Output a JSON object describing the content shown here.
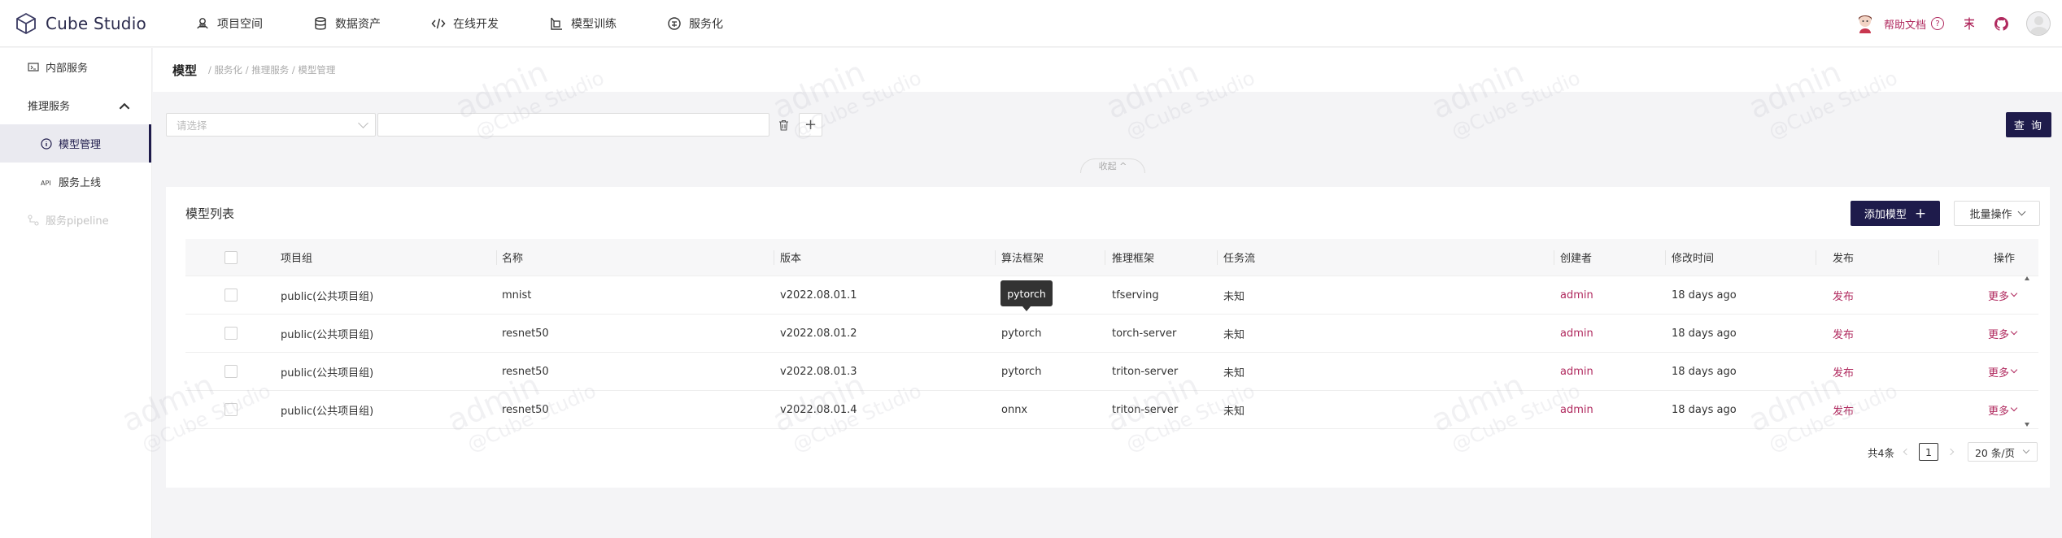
{
  "app": {
    "name": "Cube Studio"
  },
  "nav": [
    {
      "label": "项目空间",
      "icon": "project-icon"
    },
    {
      "label": "数据资产",
      "icon": "database-icon"
    },
    {
      "label": "在线开发",
      "icon": "code-icon"
    },
    {
      "label": "模型训练",
      "icon": "training-icon"
    },
    {
      "label": "服务化",
      "icon": "service-icon"
    }
  ],
  "header_right": {
    "help": "帮助文档",
    "help_icon": "?"
  },
  "sidebar": {
    "items": [
      {
        "label": "内部服务",
        "icon": "service-monitor-icon"
      },
      {
        "label": "推理服务",
        "icon": "chevron-up-icon"
      },
      {
        "label": "模型管理",
        "icon": "info-icon",
        "active": true
      },
      {
        "label": "服务上线",
        "icon": "api-icon"
      },
      {
        "label": "服务pipeline",
        "icon": "pipeline-icon",
        "disabled": true
      }
    ]
  },
  "breadcrumb": {
    "title": "模型",
    "path": "/ 服务化 / 推理服务 / 模型管理"
  },
  "filter": {
    "select_placeholder": "请选择",
    "query_label": "查 询",
    "collapse_label": "收起"
  },
  "card": {
    "title": "模型列表",
    "add_label": "添加模型",
    "batch_label": "批量操作"
  },
  "table": {
    "columns": [
      "项目组",
      "名称",
      "版本",
      "算法框架",
      "推理框架",
      "任务流",
      "创建者",
      "修改时间",
      "发布",
      "操作"
    ],
    "rows": [
      {
        "group": "public(公共项目组)",
        "name": "mnist",
        "version": "v2022.08.01.1",
        "algo": "",
        "infer": "tfserving",
        "flow": "未知",
        "creator": "admin",
        "modified": "18 days ago",
        "publish": "发布",
        "action": "更多"
      },
      {
        "group": "public(公共项目组)",
        "name": "resnet50",
        "version": "v2022.08.01.2",
        "algo": "pytorch",
        "infer": "torch-server",
        "flow": "未知",
        "creator": "admin",
        "modified": "18 days ago",
        "publish": "发布",
        "action": "更多"
      },
      {
        "group": "public(公共项目组)",
        "name": "resnet50",
        "version": "v2022.08.01.3",
        "algo": "pytorch",
        "infer": "triton-server",
        "flow": "未知",
        "creator": "admin",
        "modified": "18 days ago",
        "publish": "发布",
        "action": "更多"
      },
      {
        "group": "public(公共项目组)",
        "name": "resnet50",
        "version": "v2022.08.01.4",
        "algo": "onnx",
        "infer": "triton-server",
        "flow": "未知",
        "creator": "admin",
        "modified": "18 days ago",
        "publish": "发布",
        "action": "更多"
      }
    ]
  },
  "tooltip": {
    "text": "pytorch"
  },
  "pagination": {
    "total": "共4条",
    "current": "1",
    "page_size": "20 条/页"
  },
  "watermark": {
    "user": "admin",
    "brand": "@Cube Studio"
  },
  "colors": {
    "primary": "#1e1b4b",
    "link": "#b0295e"
  }
}
